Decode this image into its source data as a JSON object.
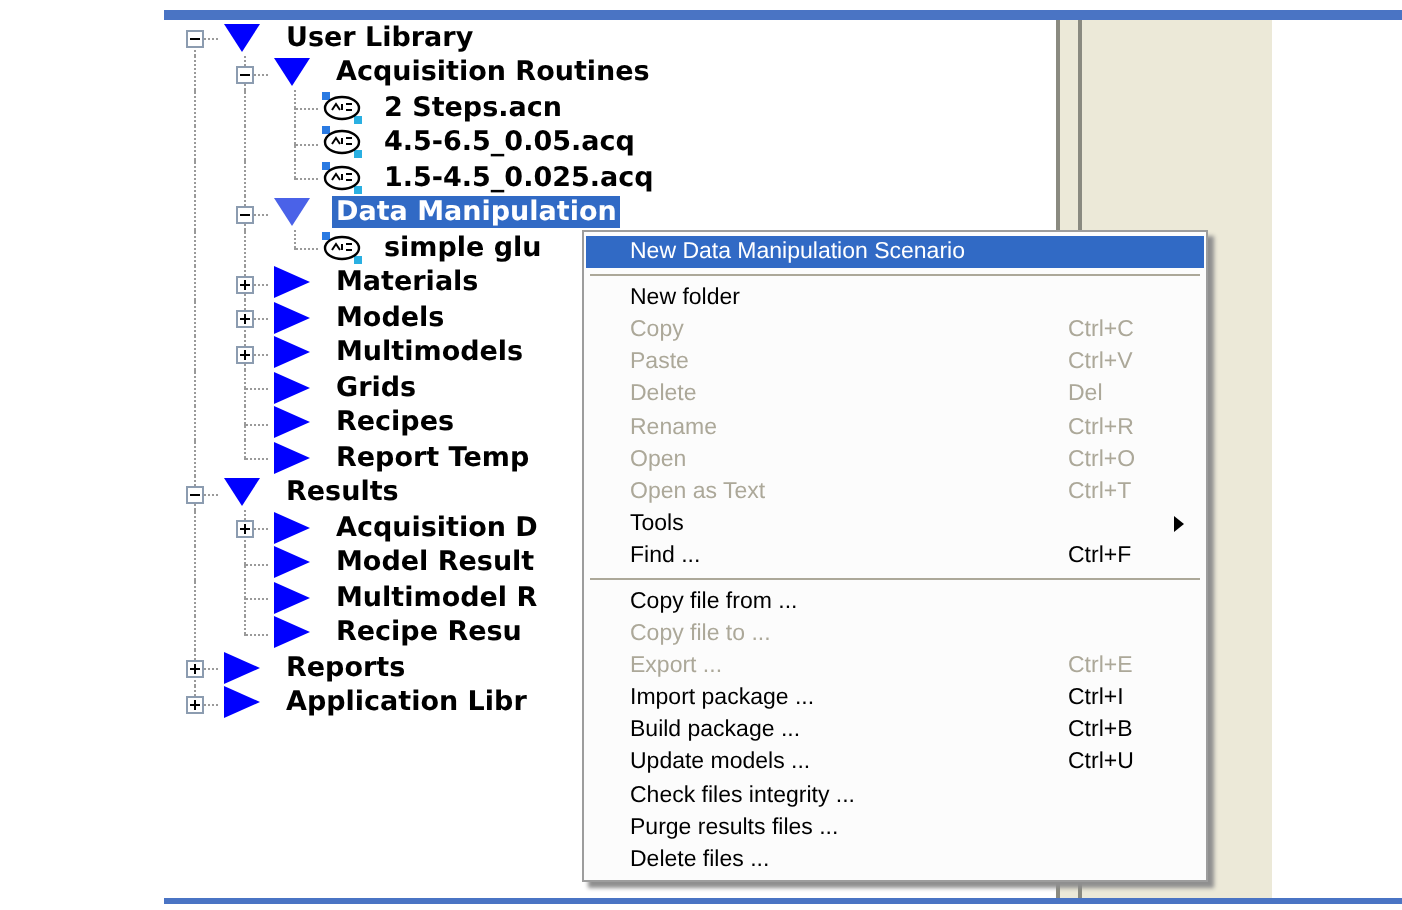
{
  "tree": [
    {
      "label": "User Library",
      "kind": "folder",
      "expanded": true,
      "selected": false,
      "children": [
        {
          "label": "Acquisition Routines",
          "kind": "folder",
          "expanded": true,
          "selected": false,
          "children": [
            {
              "label": "2 Steps.acn",
              "kind": "file",
              "selected": false
            },
            {
              "label": "4.5-6.5_0.05.acq",
              "kind": "file",
              "selected": false
            },
            {
              "label": "1.5-4.5_0.025.acq",
              "kind": "file",
              "selected": false
            }
          ]
        },
        {
          "label": "Data Manipulation",
          "kind": "folder",
          "expanded": true,
          "selected": true,
          "children": [
            {
              "label": "simple glu",
              "kind": "file",
              "selected": false
            }
          ]
        },
        {
          "label": "Materials",
          "kind": "folder",
          "expanded": false,
          "selected": false
        },
        {
          "label": "Models",
          "kind": "folder",
          "expanded": false,
          "selected": false
        },
        {
          "label": "Multimodels",
          "kind": "folder",
          "expanded": false,
          "selected": false
        },
        {
          "label": "Grids",
          "kind": "folder",
          "selected": false
        },
        {
          "label": "Recipes",
          "kind": "folder",
          "selected": false
        },
        {
          "label": "Report Temp",
          "kind": "folder",
          "selected": false
        }
      ]
    },
    {
      "label": "Results",
      "kind": "folder",
      "expanded": true,
      "selected": false,
      "children": [
        {
          "label": "Acquisition D",
          "kind": "folder",
          "expanded": false,
          "selected": false
        },
        {
          "label": "Model Result",
          "kind": "folder",
          "selected": false
        },
        {
          "label": "Multimodel R",
          "kind": "folder",
          "selected": false
        },
        {
          "label": "Recipe Resu",
          "kind": "folder",
          "selected": false
        }
      ]
    },
    {
      "label": "Reports",
      "kind": "folder",
      "expanded": false,
      "selected": false
    },
    {
      "label": "Application Libr",
      "kind": "folder",
      "expanded": false,
      "selected": false
    }
  ],
  "context_menu": [
    {
      "kind": "item",
      "label": "New Data Manipulation Scenario",
      "disabled": false,
      "selected": true
    },
    {
      "kind": "separator"
    },
    {
      "kind": "item",
      "label": "New folder",
      "disabled": false,
      "selected": false
    },
    {
      "kind": "item",
      "label": "Copy",
      "shortcut": "Ctrl+C",
      "disabled": true,
      "selected": false
    },
    {
      "kind": "item",
      "label": "Paste",
      "shortcut": "Ctrl+V",
      "disabled": true,
      "selected": false
    },
    {
      "kind": "item",
      "label": "Delete",
      "shortcut": "Del",
      "disabled": true,
      "selected": false
    },
    {
      "kind": "item",
      "label": "Rename",
      "shortcut": "Ctrl+R",
      "disabled": true,
      "selected": false
    },
    {
      "kind": "item",
      "label": "Open",
      "shortcut": "Ctrl+O",
      "disabled": true,
      "selected": false
    },
    {
      "kind": "item",
      "label": "Open as Text",
      "shortcut": "Ctrl+T",
      "disabled": true,
      "selected": false
    },
    {
      "kind": "submenu",
      "label": "Tools",
      "disabled": false,
      "selected": false
    },
    {
      "kind": "item",
      "label": "Find ...",
      "shortcut": "Ctrl+F",
      "disabled": false,
      "selected": false
    },
    {
      "kind": "separator"
    },
    {
      "kind": "item",
      "label": "Copy file from ...",
      "disabled": false,
      "selected": false
    },
    {
      "kind": "item",
      "label": "Copy file to ...",
      "disabled": true,
      "selected": false
    },
    {
      "kind": "item",
      "label": "Export ...",
      "shortcut": "Ctrl+E",
      "disabled": true,
      "selected": false
    },
    {
      "kind": "item",
      "label": "Import package ...",
      "shortcut": "Ctrl+I",
      "disabled": false,
      "selected": false
    },
    {
      "kind": "item",
      "label": "Build package ...",
      "shortcut": "Ctrl+B",
      "disabled": false,
      "selected": false
    },
    {
      "kind": "item",
      "label": "Update models ...",
      "shortcut": "Ctrl+U",
      "disabled": false,
      "selected": false
    },
    {
      "kind": "item",
      "label": "Check files integrity ...",
      "disabled": false,
      "selected": false
    },
    {
      "kind": "item",
      "label": "Purge results files ...",
      "disabled": false,
      "selected": false
    },
    {
      "kind": "item",
      "label": "Delete files ...",
      "disabled": false,
      "selected": false
    }
  ]
}
